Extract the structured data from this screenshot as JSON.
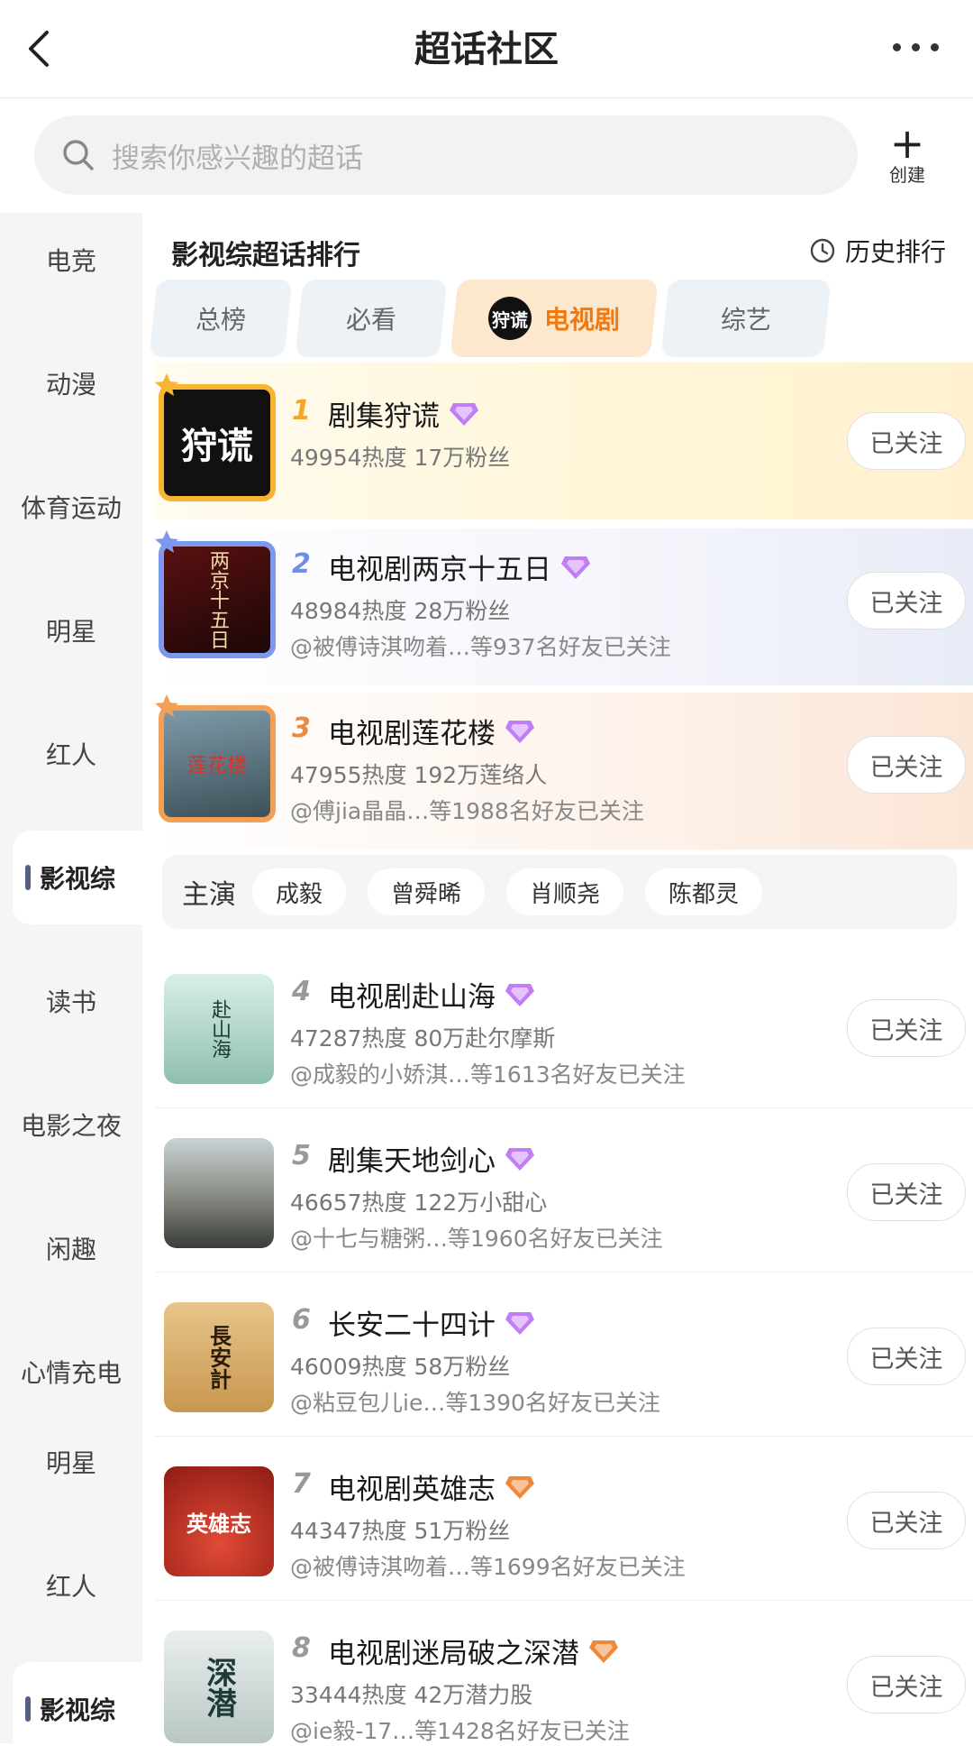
{
  "header": {
    "title": "超话社区"
  },
  "search": {
    "placeholder": "搜索你感兴趣的超话",
    "create_label": "创建"
  },
  "sidebar": {
    "items": [
      "电竞",
      "动漫",
      "体育运动",
      "明星",
      "红人",
      "影视综",
      "读书",
      "电影之夜",
      "闲趣",
      "心情充电",
      "明星",
      "红人",
      "影视综"
    ],
    "active_index": 5
  },
  "section": {
    "title": "影视综超话排行",
    "history_label": "历史排行"
  },
  "tabs": [
    {
      "label": "总榜"
    },
    {
      "label": "必看"
    },
    {
      "label": "电视剧",
      "logo_text": "狩谎"
    },
    {
      "label": "综艺"
    }
  ],
  "rankings": [
    {
      "rank": "1",
      "name": "剧集狩谎",
      "stats": "49954热度 17万粉丝",
      "friends": "",
      "follow": "已关注",
      "cover_text": "狩谎",
      "badge": "purple"
    },
    {
      "rank": "2",
      "name": "电视剧两京十五日",
      "stats": "48984热度 28万粉丝",
      "friends": "@被傅诗淇吻着…等937名好友已关注",
      "follow": "已关注",
      "cover_text": "两京十五日",
      "badge": "purple"
    },
    {
      "rank": "3",
      "name": "电视剧莲花楼",
      "stats": "47955热度 192万莲络人",
      "friends": "@傅jia晶晶…等1988名好友已关注",
      "follow": "已关注",
      "cover_text": "莲花楼",
      "badge": "purple"
    },
    {
      "rank": "4",
      "name": "电视剧赴山海",
      "stats": "47287热度 80万赴尔摩斯",
      "friends": "@成毅的小娇淇…等1613名好友已关注",
      "follow": "已关注",
      "cover_text": "赴山海",
      "badge": "purple"
    },
    {
      "rank": "5",
      "name": "剧集天地剑心",
      "stats": "46657热度 122万小甜心",
      "friends": "@十七与糖粥…等1960名好友已关注",
      "follow": "已关注",
      "cover_text": "",
      "badge": "purple"
    },
    {
      "rank": "6",
      "name": "长安二十四计",
      "stats": "46009热度 58万粉丝",
      "friends": "@粘豆包儿ie…等1390名好友已关注",
      "follow": "已关注",
      "cover_text": "長安計",
      "badge": "purple"
    },
    {
      "rank": "7",
      "name": "电视剧英雄志",
      "stats": "44347热度 51万粉丝",
      "friends": "@被傅诗淇吻着…等1699名好友已关注",
      "follow": "已关注",
      "cover_text": "英雄志",
      "badge": "orange"
    },
    {
      "rank": "8",
      "name": "电视剧迷局破之深潜",
      "stats": "33444热度 42万潜力股",
      "friends": "@ie毅-17…等1428名好友已关注",
      "follow": "已关注",
      "cover_text": "深潜",
      "badge": "orange"
    }
  ],
  "cast": {
    "label": "主演",
    "members": [
      "成毅",
      "曾舜晞",
      "肖顺尧",
      "陈都灵"
    ]
  },
  "colors": {
    "accent": "#f07a11",
    "gold": "#f7b531",
    "silver_blue": "#7c99ee",
    "bronze": "#f2a055",
    "badge_purple": "#b15cf0",
    "badge_orange": "#f0883a"
  }
}
